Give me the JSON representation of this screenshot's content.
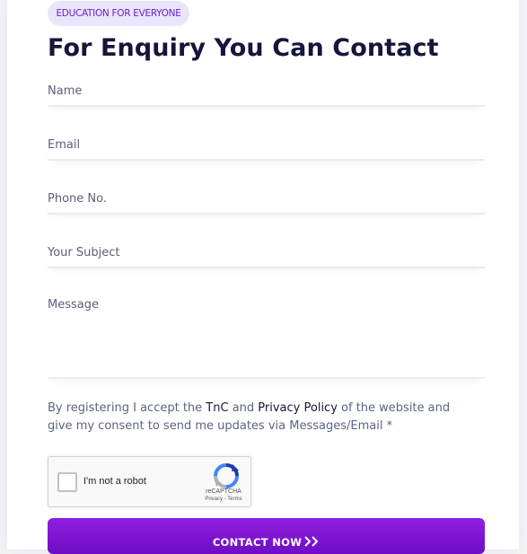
{
  "header": {
    "badge": "EDUCATION FOR EVERYONE",
    "title": "For Enquiry You Can Contact"
  },
  "form": {
    "name_placeholder": "Name",
    "email_placeholder": "Email",
    "phone_placeholder": "Phone No.",
    "subject_placeholder": "Your Subject",
    "message_placeholder": "Message"
  },
  "consent": {
    "prefix": "By registering I accept the ",
    "tnc": "TnC",
    "and": " and ",
    "privacy": "Privacy Policy",
    "suffix": " of the website and give my consent to send me updates via Messages/Email *"
  },
  "captcha": {
    "label": "I'm not a robot",
    "brand": "reCAPTCHA",
    "terms": "Privacy - Terms"
  },
  "submit": {
    "label": "CONTACT NOW"
  },
  "colors": {
    "accent": "#7a12d0",
    "title": "#15163a",
    "badge_bg": "#e9e6fb"
  }
}
